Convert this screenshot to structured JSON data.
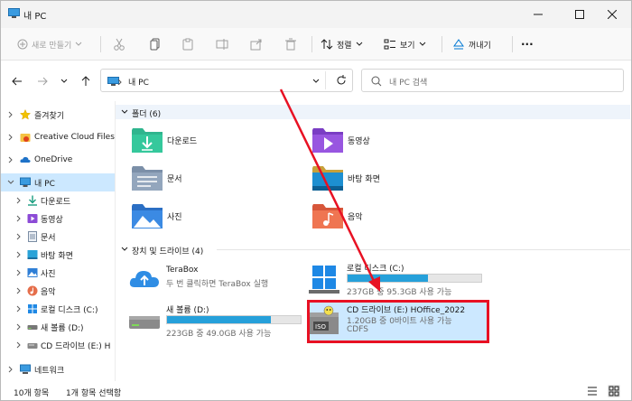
{
  "window": {
    "title": "내 PC"
  },
  "commandbar": {
    "new_label": "새로 만들기",
    "sort_label": "정렬",
    "view_label": "보기",
    "eject_label": "꺼내기",
    "more_label": "···"
  },
  "addressbar": {
    "crumb": "내 PC",
    "search_placeholder": "내 PC 검색"
  },
  "sidebar": {
    "items": [
      {
        "label": "즐겨찾기"
      },
      {
        "label": "Creative Cloud Files"
      },
      {
        "label": "OneDrive"
      },
      {
        "label": "내 PC"
      },
      {
        "label": "다운로드"
      },
      {
        "label": "동영상"
      },
      {
        "label": "문서"
      },
      {
        "label": "바탕 화면"
      },
      {
        "label": "사진"
      },
      {
        "label": "음악"
      },
      {
        "label": "로컬 디스크 (C:)"
      },
      {
        "label": "새 볼륨 (D:)"
      },
      {
        "label": "CD 드라이브 (E:) H"
      },
      {
        "label": "네트워크"
      }
    ]
  },
  "main": {
    "folders_header": "폴더 (6)",
    "folders": [
      {
        "name": "다운로드"
      },
      {
        "name": "동영상"
      },
      {
        "name": "문서"
      },
      {
        "name": "바탕 화면"
      },
      {
        "name": "사진"
      },
      {
        "name": "음악"
      }
    ],
    "drives_header": "장치 및 드라이브 (4)",
    "drives": [
      {
        "name": "TeraBox",
        "info": "두 번 클릭하면 TeraBox 실행"
      },
      {
        "name": "로컬 디스크 (C:)",
        "info": "237GB 중 95.3GB 사용 가능",
        "used_fraction": 0.6
      },
      {
        "name": "새 볼륨 (D:)",
        "info": "223GB 중 49.0GB 사용 가능",
        "used_fraction": 0.78
      },
      {
        "name": "CD 드라이브 (E:) HOffice_2022",
        "info": "1.20GB 중 0바이트 사용 가능",
        "info2": "CDFS"
      }
    ]
  },
  "statusbar": {
    "count": "10개 항목",
    "selected": "1개 항목 선택함"
  },
  "colors": {
    "accent": "#0078d4",
    "selection": "#cce8ff",
    "drive_bar": "#26a0da",
    "highlight_box": "#e81123"
  }
}
